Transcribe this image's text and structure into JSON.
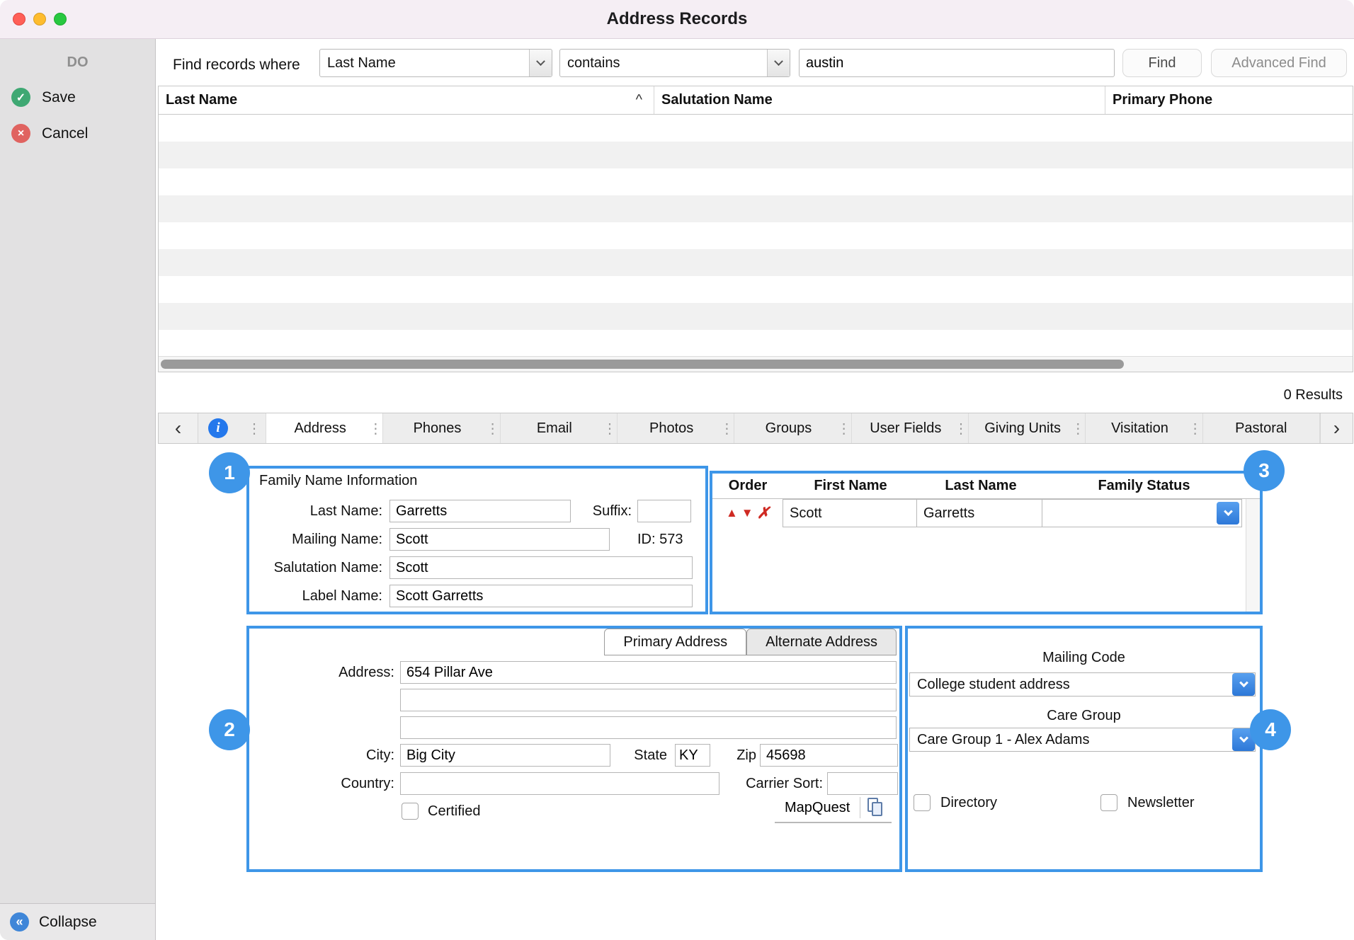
{
  "window": {
    "title": "Address Records"
  },
  "icons": {
    "dots": "⋮",
    "chevron_left": "‹",
    "chevron_right": "›",
    "sort_asc": "^",
    "info": "i",
    "save_check": "✓",
    "cancel_x": "×",
    "collapse": "«",
    "move_up": "▲",
    "move_down": "▼",
    "delete_row": "✗"
  },
  "sidebar": {
    "header": "DO",
    "save_label": "Save",
    "cancel_label": "Cancel",
    "collapse_label": "Collapse"
  },
  "search": {
    "label": "Find records where",
    "field_value": "Last Name",
    "operator_value": "contains",
    "query_value": "austin",
    "find_label": "Find",
    "advanced_find_label": "Advanced Find"
  },
  "results": {
    "columns": [
      "Last Name",
      "Salutation Name",
      "Primary Phone"
    ],
    "count_text": "0 Results"
  },
  "tabs": [
    "Address",
    "Phones",
    "Email",
    "Photos",
    "Groups",
    "User Fields",
    "Giving Units",
    "Visitation",
    "Pastoral"
  ],
  "annotations": {
    "one": "1",
    "two": "2",
    "three": "3",
    "four": "4"
  },
  "family_info": {
    "title": "Family Name Information",
    "last_name_label": "Last Name:",
    "last_name_value": "Garretts",
    "suffix_label": "Suffix:",
    "suffix_value": "",
    "mailing_name_label": "Mailing Name:",
    "mailing_name_value": "Scott",
    "id_text": "ID: 573",
    "salutation_name_label": "Salutation Name:",
    "salutation_name_value": "Scott",
    "label_name_label": "Label Name:",
    "label_name_value": "Scott Garretts"
  },
  "members": {
    "columns": [
      "Order",
      "First Name",
      "Last Name",
      "Family Status"
    ],
    "rows": [
      {
        "first_name": "Scott",
        "last_name": "Garretts",
        "family_status": ""
      }
    ]
  },
  "address": {
    "tabs": [
      "Primary Address",
      "Alternate Address"
    ],
    "active_tab": "Primary Address",
    "address_label": "Address:",
    "line1": "654 Pillar Ave",
    "line2": "",
    "line3": "",
    "city_label": "City:",
    "city_value": "Big City",
    "state_label": "State",
    "state_value": "KY",
    "zip_label": "Zip",
    "zip_value": "45698",
    "country_label": "Country:",
    "country_value": "",
    "carrier_sort_label": "Carrier Sort:",
    "carrier_sort_value": "",
    "certified_label": "Certified",
    "mapquest_label": "MapQuest"
  },
  "codes": {
    "mailing_code_label": "Mailing Code",
    "mailing_code_value": "College student address",
    "care_group_label": "Care Group",
    "care_group_value": "Care Group 1 - Alex Adams",
    "directory_label": "Directory",
    "newsletter_label": "Newsletter"
  }
}
